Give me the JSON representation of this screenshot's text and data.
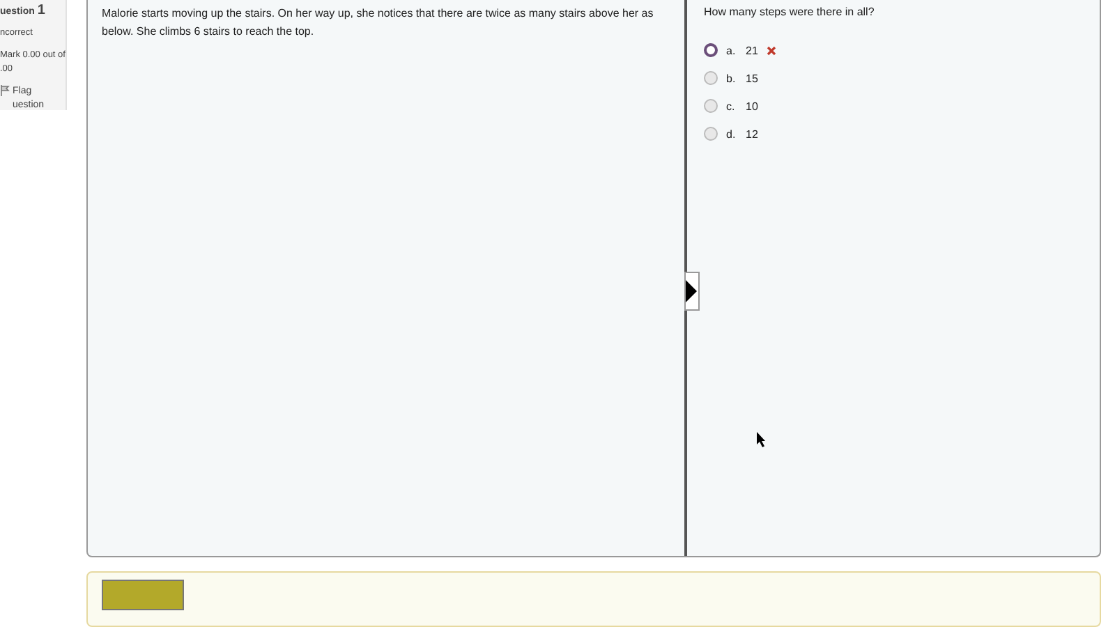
{
  "info": {
    "question_label": "uestion",
    "question_number": "1",
    "status": "ncorrect",
    "mark_line1": "Mark 0.00 out of",
    "mark_line2": ".00",
    "flag_line1": "Flag",
    "flag_line2": "uestion"
  },
  "question": {
    "text": "Malorie starts moving up the stairs. On her way up, she notices that there are twice as many stairs above her as below. She climbs 6 stairs to reach the top.",
    "prompt": "How many steps were there in all?",
    "options": [
      {
        "letter": "a.",
        "answer": "21",
        "selected": true,
        "incorrect": true
      },
      {
        "letter": "b.",
        "answer": "15",
        "selected": false,
        "incorrect": false
      },
      {
        "letter": "c.",
        "answer": "10",
        "selected": false,
        "incorrect": false
      },
      {
        "letter": "d.",
        "answer": "12",
        "selected": false,
        "incorrect": false
      }
    ]
  }
}
